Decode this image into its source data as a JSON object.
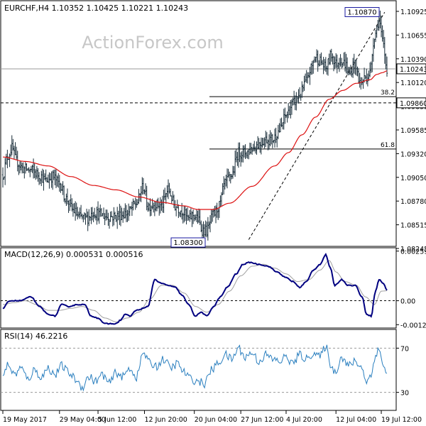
{
  "chart_data": {
    "type": "ohlc",
    "symbol_header": "EURCHF,H4  1.10352 1.10425 1.10221 1.10243",
    "watermark": "ActionForex.com",
    "colors": {
      "background": "#ffffff",
      "bars": "#1a2e3a",
      "ma": "#dd1111",
      "macd": "#000080",
      "signal": "#a0a0a0",
      "rsi": "#2a7fbf",
      "level": "#000000",
      "axis": "#000000",
      "label_border": "#1a1aa0"
    },
    "price_axis": {
      "ylim": [
        1.0826,
        1.1097
      ],
      "ticks": [
        "1.10925",
        "1.10655",
        "1.10390",
        "1.10120",
        "1.09855",
        "1.09585",
        "1.09320",
        "1.09050",
        "1.08780",
        "1.08515",
        "1.08245"
      ],
      "current_price": "1.10243",
      "current_value": 1.10243
    },
    "price_annotations": [
      {
        "text": "1.10870",
        "value": 1.1087
      },
      {
        "text": "1.08300",
        "value": 1.083
      }
    ],
    "fib_levels": [
      {
        "label": "38.2",
        "value": 1.0993
      },
      {
        "label": "61.8",
        "value": 1.0934
      }
    ],
    "support_line": {
      "label": "1.09860",
      "value": 1.0986
    },
    "trend_line": {
      "from": [
        1.0832,
        217
      ],
      "to": [
        1.1088,
        380
      ]
    },
    "price_anchors": [
      [
        0,
        1.0905
      ],
      [
        4,
        1.0925
      ],
      [
        8,
        1.0935
      ],
      [
        12,
        1.092
      ],
      [
        18,
        1.0912
      ],
      [
        25,
        1.091
      ],
      [
        32,
        1.0905
      ],
      [
        38,
        1.0898
      ],
      [
        44,
        1.0903
      ],
      [
        50,
        1.0895
      ],
      [
        56,
        1.0878
      ],
      [
        62,
        1.0865
      ],
      [
        68,
        1.0857
      ],
      [
        74,
        1.0856
      ],
      [
        80,
        1.0863
      ],
      [
        86,
        1.086
      ],
      [
        92,
        1.0858
      ],
      [
        98,
        1.0858
      ],
      [
        104,
        1.086
      ],
      [
        110,
        1.0862
      ],
      [
        118,
        1.0873
      ],
      [
        124,
        1.0892
      ],
      [
        128,
        1.087
      ],
      [
        134,
        1.0872
      ],
      [
        140,
        1.087
      ],
      [
        146,
        1.0888
      ],
      [
        152,
        1.087
      ],
      [
        158,
        1.0865
      ],
      [
        164,
        1.0855
      ],
      [
        168,
        1.086
      ],
      [
        172,
        1.0855
      ],
      [
        176,
        1.0843
      ],
      [
        180,
        1.0842
      ],
      [
        186,
        1.086
      ],
      [
        191,
        1.087
      ],
      [
        196,
        1.0895
      ],
      [
        202,
        1.0905
      ],
      [
        208,
        1.093
      ],
      [
        214,
        1.093
      ],
      [
        220,
        1.0935
      ],
      [
        226,
        1.094
      ],
      [
        232,
        1.0945
      ],
      [
        238,
        1.0945
      ],
      [
        244,
        1.0955
      ],
      [
        250,
        1.0972
      ],
      [
        256,
        1.0985
      ],
      [
        262,
        1.0995
      ],
      [
        268,
        1.101
      ],
      [
        272,
        1.1025
      ],
      [
        276,
        1.1038
      ],
      [
        280,
        1.1033
      ],
      [
        285,
        1.1025
      ],
      [
        290,
        1.104
      ],
      [
        294,
        1.103
      ],
      [
        298,
        1.1035
      ],
      [
        302,
        1.103
      ],
      [
        306,
        1.1018
      ],
      [
        310,
        1.103
      ],
      [
        316,
        1.1008
      ],
      [
        320,
        1.1015
      ],
      [
        324,
        1.102
      ],
      [
        328,
        1.1062
      ],
      [
        332,
        1.108
      ],
      [
        335,
        1.1055
      ],
      [
        339,
        1.1025
      ]
    ],
    "ma_anchors": [
      [
        0,
        1.0925
      ],
      [
        20,
        1.092
      ],
      [
        40,
        1.0915
      ],
      [
        60,
        1.0903
      ],
      [
        80,
        1.0893
      ],
      [
        100,
        1.0888
      ],
      [
        120,
        1.088
      ],
      [
        140,
        1.0874
      ],
      [
        160,
        1.087
      ],
      [
        172,
        1.0866
      ],
      [
        186,
        1.0866
      ],
      [
        200,
        1.0873
      ],
      [
        220,
        1.0892
      ],
      [
        240,
        1.0915
      ],
      [
        252,
        1.093
      ],
      [
        264,
        1.095
      ],
      [
        276,
        1.097
      ],
      [
        288,
        1.099
      ],
      [
        300,
        1.1
      ],
      [
        312,
        1.1008
      ],
      [
        324,
        1.1012
      ],
      [
        330,
        1.1018
      ],
      [
        335,
        1.102
      ],
      [
        339,
        1.1022
      ]
    ],
    "macd_ylim": [
      -0.00135,
      0.00265
    ],
    "macd_ticks": [
      "0.00259",
      "0.00",
      "-0.00125"
    ],
    "macd_label": "MACD(12,26,9) 0.000531 0.000516",
    "macd_anchors": [
      [
        0,
        -0.0004
      ],
      [
        6,
        0.0
      ],
      [
        15,
        0.0
      ],
      [
        25,
        0.0002
      ],
      [
        32,
        -0.0003
      ],
      [
        40,
        -0.0007
      ],
      [
        46,
        -0.0008
      ],
      [
        52,
        -0.0002
      ],
      [
        58,
        -0.0003
      ],
      [
        66,
        -0.0002
      ],
      [
        72,
        -0.0002
      ],
      [
        78,
        -0.0008
      ],
      [
        84,
        -0.0009
      ],
      [
        90,
        -0.0012
      ],
      [
        96,
        -0.0012
      ],
      [
        100,
        -0.0012
      ],
      [
        104,
        -0.001
      ],
      [
        108,
        -0.0007
      ],
      [
        112,
        -0.0008
      ],
      [
        118,
        -0.0005
      ],
      [
        124,
        -0.0004
      ],
      [
        128,
        -0.0003
      ],
      [
        134,
        0.0011
      ],
      [
        140,
        0.0009
      ],
      [
        146,
        0.0008
      ],
      [
        152,
        0.0007
      ],
      [
        158,
        0.0003
      ],
      [
        164,
        -0.0002
      ],
      [
        170,
        -0.0008
      ],
      [
        175,
        -0.0006
      ],
      [
        180,
        -0.0008
      ],
      [
        186,
        -0.0003
      ],
      [
        192,
        0.0002
      ],
      [
        198,
        0.0007
      ],
      [
        206,
        0.0014
      ],
      [
        212,
        0.0019
      ],
      [
        218,
        0.002
      ],
      [
        226,
        0.0019
      ],
      [
        234,
        0.0018
      ],
      [
        242,
        0.0015
      ],
      [
        250,
        0.0012
      ],
      [
        256,
        0.001
      ],
      [
        262,
        0.0007
      ],
      [
        268,
        0.001
      ],
      [
        274,
        0.0016
      ],
      [
        280,
        0.0019
      ],
      [
        285,
        0.0024
      ],
      [
        289,
        0.0017
      ],
      [
        293,
        0.0008
      ],
      [
        299,
        0.0011
      ],
      [
        305,
        0.0008
      ],
      [
        311,
        0.0008
      ],
      [
        317,
        0.0002
      ],
      [
        321,
        -0.0007
      ],
      [
        325,
        -0.0008
      ],
      [
        329,
        0.0005
      ],
      [
        332,
        0.0011
      ],
      [
        336,
        0.0009
      ],
      [
        339,
        0.00053
      ]
    ],
    "signal_anchors": [
      [
        0,
        -0.0002
      ],
      [
        10,
        -0.0001
      ],
      [
        20,
        0.0
      ],
      [
        30,
        -0.0002
      ],
      [
        40,
        -0.0005
      ],
      [
        50,
        -0.0005
      ],
      [
        60,
        -0.0004
      ],
      [
        70,
        -0.0003
      ],
      [
        80,
        -0.0005
      ],
      [
        90,
        -0.0009
      ],
      [
        100,
        -0.0011
      ],
      [
        110,
        -0.0009
      ],
      [
        120,
        -0.0006
      ],
      [
        130,
        0.0001
      ],
      [
        140,
        0.0008
      ],
      [
        150,
        0.0008
      ],
      [
        160,
        0.0004
      ],
      [
        170,
        -0.0003
      ],
      [
        180,
        -0.0006
      ],
      [
        190,
        -0.0002
      ],
      [
        200,
        0.0005
      ],
      [
        210,
        0.0013
      ],
      [
        220,
        0.0018
      ],
      [
        230,
        0.0019
      ],
      [
        240,
        0.0017
      ],
      [
        250,
        0.0014
      ],
      [
        260,
        0.001
      ],
      [
        270,
        0.0011
      ],
      [
        280,
        0.0016
      ],
      [
        288,
        0.0021
      ],
      [
        294,
        0.0015
      ],
      [
        302,
        0.001
      ],
      [
        312,
        0.0008
      ],
      [
        320,
        0.0002
      ],
      [
        328,
        -0.0002
      ],
      [
        334,
        0.0005
      ],
      [
        339,
        0.00052
      ]
    ],
    "rsi_ylim": [
      15,
      85
    ],
    "rsi_ticks": [
      "70",
      "30"
    ],
    "rsi_label": "RSI(14) 46.2216",
    "rsi_anchors": [
      [
        0,
        48
      ],
      [
        5,
        55
      ],
      [
        10,
        46
      ],
      [
        16,
        52
      ],
      [
        22,
        42
      ],
      [
        28,
        50
      ],
      [
        34,
        44
      ],
      [
        40,
        52
      ],
      [
        46,
        46
      ],
      [
        52,
        54
      ],
      [
        58,
        48
      ],
      [
        64,
        42
      ],
      [
        70,
        35
      ],
      [
        76,
        44
      ],
      [
        82,
        40
      ],
      [
        88,
        46
      ],
      [
        94,
        38
      ],
      [
        100,
        48
      ],
      [
        106,
        44
      ],
      [
        112,
        52
      ],
      [
        118,
        44
      ],
      [
        124,
        66
      ],
      [
        130,
        56
      ],
      [
        136,
        54
      ],
      [
        142,
        60
      ],
      [
        148,
        52
      ],
      [
        154,
        56
      ],
      [
        160,
        48
      ],
      [
        166,
        42
      ],
      [
        172,
        40
      ],
      [
        178,
        38
      ],
      [
        184,
        50
      ],
      [
        190,
        56
      ],
      [
        196,
        64
      ],
      [
        202,
        60
      ],
      [
        208,
        70
      ],
      [
        214,
        62
      ],
      [
        220,
        66
      ],
      [
        226,
        58
      ],
      [
        232,
        64
      ],
      [
        238,
        60
      ],
      [
        244,
        58
      ],
      [
        250,
        62
      ],
      [
        256,
        56
      ],
      [
        262,
        64
      ],
      [
        268,
        60
      ],
      [
        274,
        66
      ],
      [
        280,
        62
      ],
      [
        285,
        72
      ],
      [
        289,
        56
      ],
      [
        293,
        48
      ],
      [
        299,
        62
      ],
      [
        305,
        54
      ],
      [
        311,
        58
      ],
      [
        317,
        52
      ],
      [
        321,
        40
      ],
      [
        325,
        45
      ],
      [
        329,
        65
      ],
      [
        332,
        68
      ],
      [
        336,
        55
      ],
      [
        339,
        46
      ]
    ],
    "time_labels": [
      {
        "text": "19 May 2017",
        "bar": 0
      },
      {
        "text": "29 May 04:00",
        "bar": 50
      },
      {
        "text": "5 Jun 12:00",
        "bar": 84
      },
      {
        "text": "12 Jun 20:00",
        "bar": 125
      },
      {
        "text": "20 Jun 04:00",
        "bar": 169
      },
      {
        "text": "27 Jun 12:00",
        "bar": 210
      },
      {
        "text": "4 Jul 20:00",
        "bar": 250
      },
      {
        "text": "12 Jul 04:00",
        "bar": 294
      },
      {
        "text": "19 Jul 12:00",
        "bar": 334
      }
    ]
  }
}
